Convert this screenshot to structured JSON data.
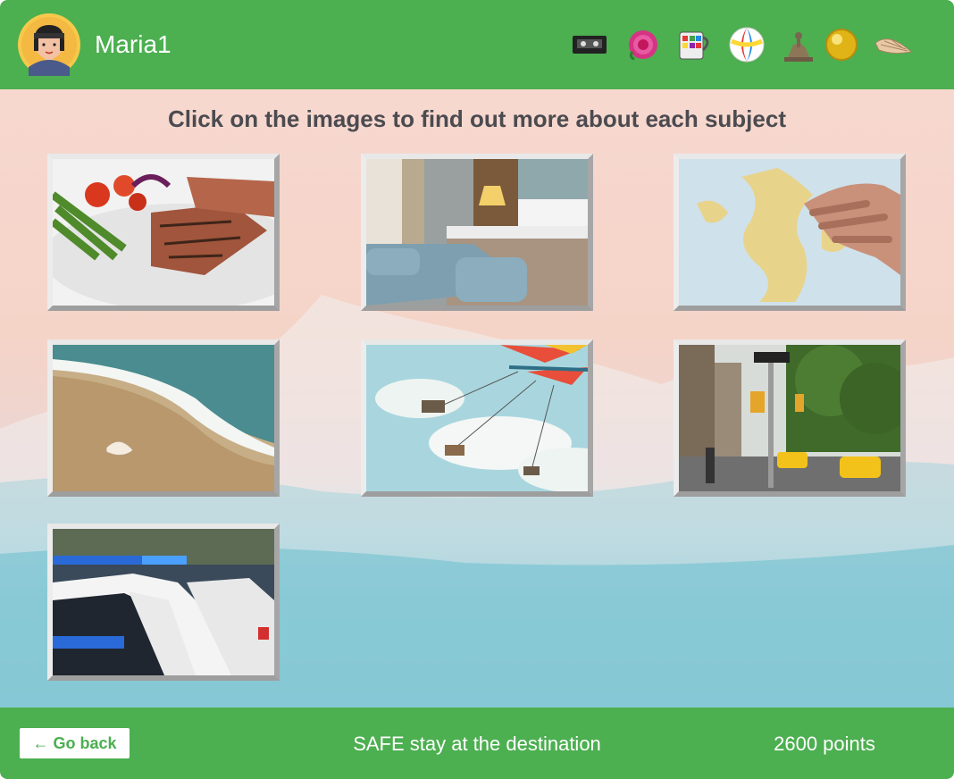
{
  "header": {
    "username": "Maria1",
    "collectibles": [
      {
        "name": "vhs-tape-icon"
      },
      {
        "name": "rose-icon"
      },
      {
        "name": "mug-icon"
      },
      {
        "name": "beach-ball-icon"
      },
      {
        "name": "statue-icon"
      },
      {
        "name": "gold-ball-icon"
      },
      {
        "name": "seashell-icon"
      }
    ]
  },
  "main": {
    "instruction": "Click on the images to find out more about each subject",
    "tiles": [
      {
        "subject": "food"
      },
      {
        "subject": "hotel-room"
      },
      {
        "subject": "map"
      },
      {
        "subject": "beach"
      },
      {
        "subject": "swing-ride"
      },
      {
        "subject": "city-street"
      },
      {
        "subject": "police-car"
      }
    ]
  },
  "footer": {
    "back_label": "← Go back",
    "title": "SAFE stay at the destination",
    "points": "2600 points"
  },
  "colors": {
    "brand_green": "#4caf50",
    "title_text": "#4b4b50"
  }
}
